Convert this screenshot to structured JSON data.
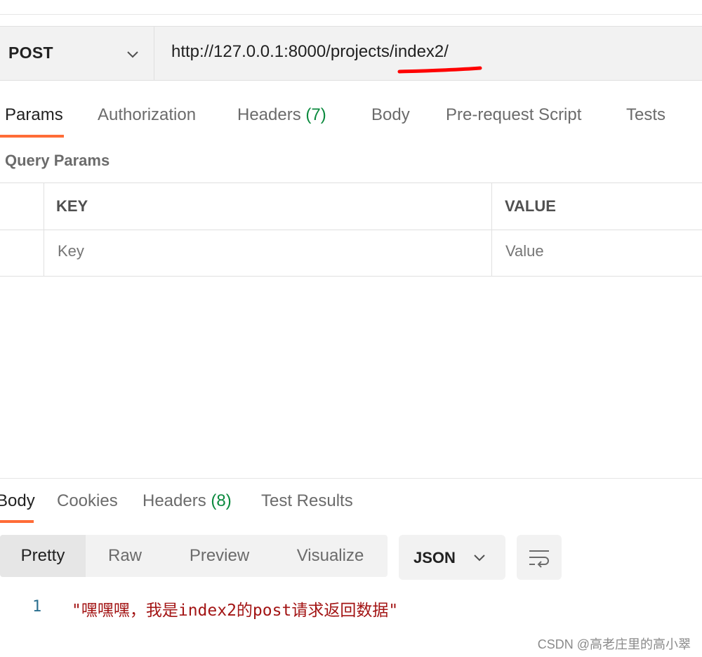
{
  "request": {
    "method": "POST",
    "url": "http://127.0.0.1:8000/projects/index2/"
  },
  "request_tabs": [
    {
      "label": "Params",
      "count": ""
    },
    {
      "label": "Authorization",
      "count": ""
    },
    {
      "label": "Headers",
      "count": "(7)"
    },
    {
      "label": "Body",
      "count": ""
    },
    {
      "label": "Pre-request Script",
      "count": ""
    },
    {
      "label": "Tests",
      "count": ""
    }
  ],
  "query_params": {
    "title": "Query Params",
    "columns": [
      "KEY",
      "VALUE"
    ],
    "placeholders": {
      "key": "Key",
      "value": "Value"
    }
  },
  "response_tabs": [
    {
      "label": "Body",
      "count": ""
    },
    {
      "label": "Cookies",
      "count": ""
    },
    {
      "label": "Headers",
      "count": "(8)"
    },
    {
      "label": "Test Results",
      "count": ""
    }
  ],
  "view_modes": [
    "Pretty",
    "Raw",
    "Preview",
    "Visualize"
  ],
  "format": "JSON",
  "response_body": {
    "line_number": "1",
    "text": "\"嘿嘿嘿，我是index2的post请求返回数据\""
  },
  "watermark": "CSDN @高老庄里的高小翠",
  "colors": {
    "accent": "#ff6c37",
    "count_green": "#0b8a3e",
    "string_red": "#a31515",
    "annotation_red": "#ff0000"
  },
  "icons": {
    "method_dropdown": "chevron-down-icon",
    "format_dropdown": "chevron-down-icon",
    "wrap": "wrap-lines-icon"
  }
}
